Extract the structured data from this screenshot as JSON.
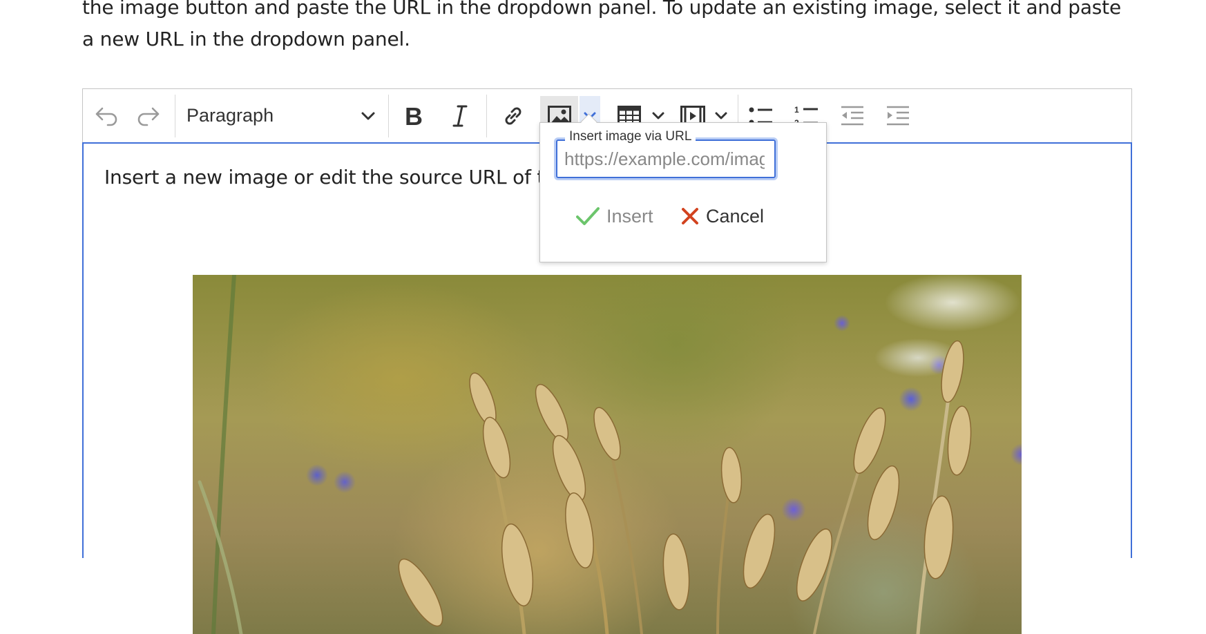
{
  "intro_text": "the image button and paste the URL in the dropdown panel. To update an existing image, select it and paste a new URL in the dropdown panel.",
  "toolbar": {
    "heading_value": "Paragraph",
    "icons": [
      "undo-icon",
      "redo-icon",
      "bold-icon",
      "italic-icon",
      "link-icon",
      "image-icon",
      "table-icon",
      "media-icon",
      "bulleted-list-icon",
      "numbered-list-icon",
      "outdent-icon",
      "indent-icon"
    ]
  },
  "content": {
    "text": "Insert a new image or edit the source URL of the im"
  },
  "popup": {
    "label": "Insert image via URL",
    "placeholder": "https://example.com/image.png",
    "value": "",
    "insert_label": "Insert",
    "cancel_label": "Cancel"
  },
  "colors": {
    "focus_blue": "#3f6fd8",
    "insert_green": "#6cc56c",
    "cancel_red": "#d2431f"
  }
}
